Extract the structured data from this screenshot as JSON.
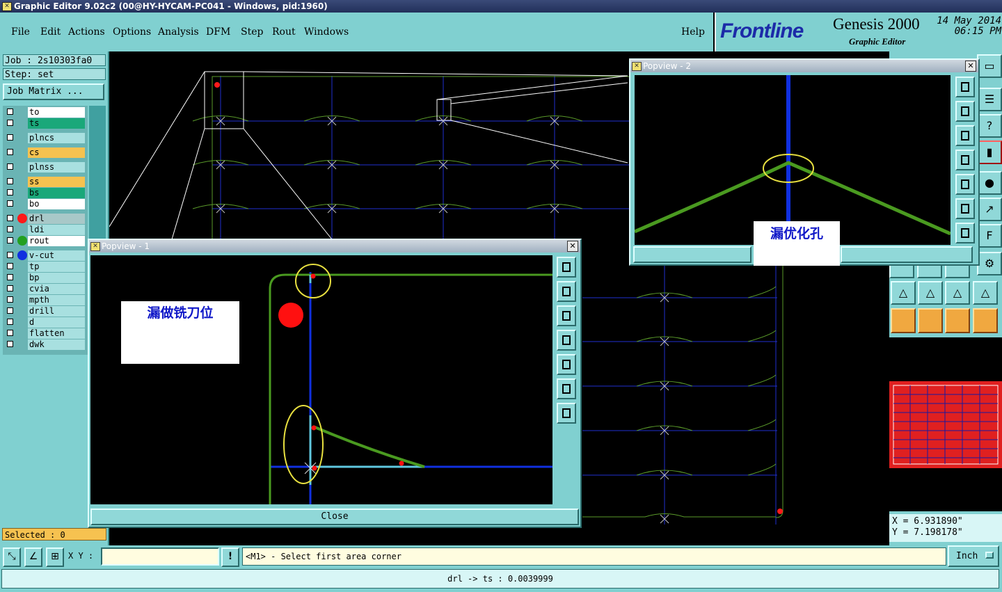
{
  "window": {
    "title": "Graphic Editor 9.02c2 (00@HY-HYCAM-PC041 - Windows, pid:1960)"
  },
  "menu": {
    "items": [
      "File",
      "Edit",
      "Actions",
      "Options",
      "Analysis",
      "DFM",
      "Step",
      "Rout",
      "Windows"
    ],
    "help": "Help"
  },
  "brand": {
    "logo": "Frontline",
    "product": "Genesis 2000",
    "subtitle": "Graphic Editor",
    "date": "14 May 2014",
    "time": "06:15 PM"
  },
  "job": {
    "job_label": "Job : 2s10303fa0",
    "step_label": "Step: set",
    "matrix_button": "Job Matrix ..."
  },
  "layers": [
    {
      "name": "to",
      "bg": "#ffffff",
      "dot": ""
    },
    {
      "name": "ts",
      "bg": "#1aa87a",
      "dot": ""
    },
    {
      "name": "plncs",
      "bg": "#a8e0e0",
      "dot": ""
    },
    {
      "name": "cs",
      "bg": "#f6c250",
      "dot": ""
    },
    {
      "name": "plnss",
      "bg": "#a8e0e0",
      "dot": ""
    },
    {
      "name": "ss",
      "bg": "#f6c250",
      "dot": ""
    },
    {
      "name": "bs",
      "bg": "#1aa87a",
      "dot": ""
    },
    {
      "name": "bo",
      "bg": "#ffffff",
      "dot": ""
    },
    {
      "name": "drl",
      "bg": "#a8c8c8",
      "dot": "#ff1a1a"
    },
    {
      "name": "ldi",
      "bg": "#a8e0e0",
      "dot": ""
    },
    {
      "name": "rout",
      "bg": "#ffffff",
      "dot": "#22a020"
    },
    {
      "name": "v-cut",
      "bg": "#a8e0e0",
      "dot": "#1030e0"
    },
    {
      "name": "tp",
      "bg": "#a8e0e0",
      "dot": ""
    },
    {
      "name": "bp",
      "bg": "#a8e0e0",
      "dot": ""
    },
    {
      "name": "cvia",
      "bg": "#a8e0e0",
      "dot": ""
    },
    {
      "name": "mpth",
      "bg": "#a8e0e0",
      "dot": ""
    },
    {
      "name": "drill",
      "bg": "#a8e0e0",
      "dot": ""
    },
    {
      "name": "d",
      "bg": "#a8e0e0",
      "dot": ""
    },
    {
      "name": "flatten",
      "bg": "#a8e0e0",
      "dot": ""
    },
    {
      "name": "dwk",
      "bg": "#a8e0e0",
      "dot": ""
    }
  ],
  "status": {
    "selected": "Selected : 0",
    "xy_label": "X Y :",
    "xy_value": "",
    "prompt": "<M1> - Select first area corner",
    "units": "Inch",
    "info": "drl -> ts : 0.0039999"
  },
  "coords": {
    "x": "X =  6.931890\"",
    "y": "Y =  7.198178\""
  },
  "popview1": {
    "title": "Popview - 1",
    "close": "Close",
    "note": "漏做铣刀位"
  },
  "popview2": {
    "title": "Popview - 2",
    "note": "漏优化孔"
  }
}
